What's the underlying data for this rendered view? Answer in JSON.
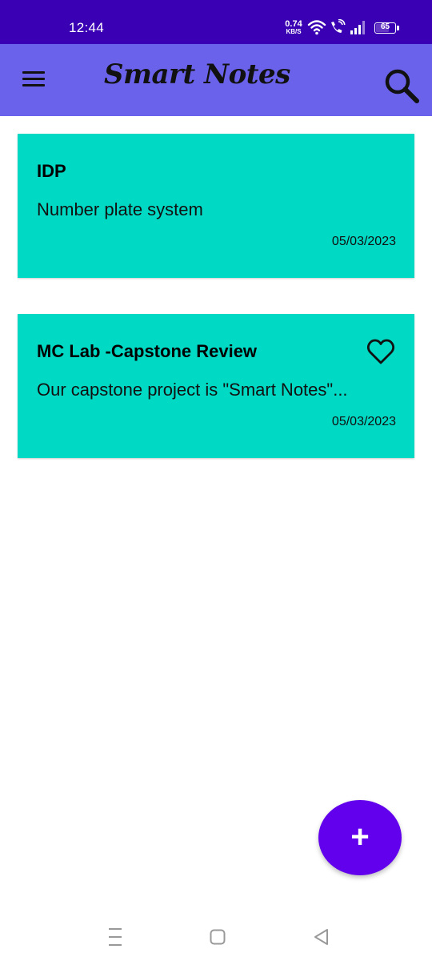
{
  "status_bar": {
    "time": "12:44",
    "network_speed_value": "0.74",
    "network_speed_unit": "KB/S",
    "battery_level": "65",
    "icons": [
      "wifi-icon",
      "wifi-call-icon",
      "signal-icon",
      "battery-icon"
    ]
  },
  "app_bar": {
    "title": "Smart Notes",
    "menu_icon": "hamburger-menu-icon",
    "search_icon": "search-icon",
    "background": "#6b62ec"
  },
  "notes": [
    {
      "title": "IDP",
      "description": "Number plate system",
      "date": "05/03/2023",
      "favorite_icon": false
    },
    {
      "title": "MC Lab -Capstone Review",
      "description": "Our capstone project is \"Smart Notes\"...",
      "date": "05/03/2023",
      "favorite_icon": true
    }
  ],
  "fab": {
    "label": "+",
    "icon": "add-icon",
    "color": "#6200ee"
  },
  "nav_bar": {
    "buttons": [
      "recents-icon",
      "home-icon",
      "back-icon"
    ]
  },
  "colors": {
    "status_bar": "#3a00b3",
    "card": "#00d9c4"
  }
}
